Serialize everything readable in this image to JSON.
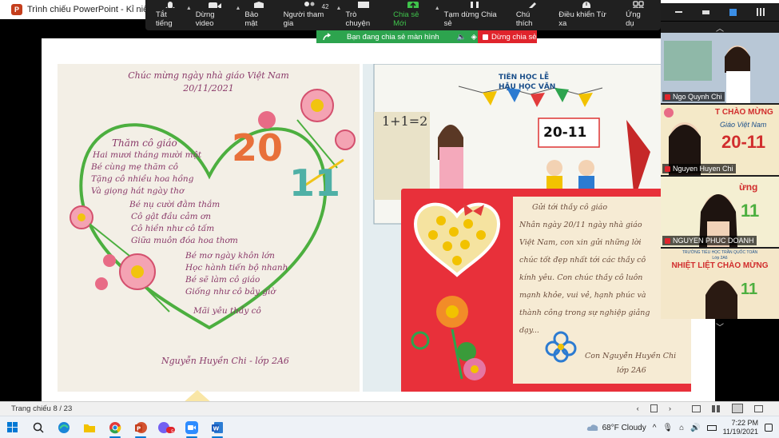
{
  "window": {
    "title": "Trình chiếu PowerPoint  -  Kỉ niệm ngày",
    "app_icon_letter": "P"
  },
  "zoom_toolbar": {
    "items": [
      {
        "key": "mute",
        "label": "Tắt tiếng",
        "icon": "microphone-icon"
      },
      {
        "key": "video",
        "label": "Dừng video",
        "icon": "video-camera-icon"
      },
      {
        "key": "security",
        "label": "Bảo mật",
        "icon": "shield-icon"
      },
      {
        "key": "participants",
        "label": "Người tham gia",
        "icon": "participants-icon",
        "count": "42"
      },
      {
        "key": "chat",
        "label": "Trò chuyện",
        "icon": "chat-bubble-icon"
      },
      {
        "key": "new_share",
        "label": "Chia sẻ Mới",
        "icon": "share-screen-icon"
      },
      {
        "key": "pause_share",
        "label": "Tạm dừng Chia sẻ",
        "icon": "pause-icon"
      },
      {
        "key": "annotate",
        "label": "Chú thích",
        "icon": "pencil-icon"
      },
      {
        "key": "remote",
        "label": "Điều khiển Từ xa",
        "icon": "mouse-icon"
      },
      {
        "key": "apps",
        "label": "Ứng dụ",
        "icon": "apps-icon"
      }
    ],
    "share_banner": "Bạn đang chia sẻ màn hình",
    "stop_share": "Dừng chia sẻ"
  },
  "slide": {
    "poem": {
      "title": [
        "Chúc mừng ngày nhà giáo Việt Nam",
        "20/11/2021"
      ],
      "stanza1": [
        "Thăm cô giáo",
        "Hai mươi tháng mười một",
        "Bé cùng mẹ thăm cô",
        "Tặng cô nhiều hoa hồng",
        "Và giọng hát ngày thơ"
      ],
      "stanza2": [
        "Bé nụ cười đằm thắm",
        "Cô gật đầu cảm ơn",
        "Cô hiền như cô tấm",
        "Giữa muôn đóa hoa thơm"
      ],
      "stanza3": [
        "Bé mơ ngày khôn lớn",
        "Học hành tiến bộ nhanh",
        "Bé sẽ làm cô giáo",
        "Giống như cô bây giờ"
      ],
      "closing": "Mãi yêu thầy cô",
      "signature": "Nguyễn Huyền Chi - lớp 2A6",
      "big_top": "20",
      "big_bottom": "11"
    },
    "card": {
      "board_title": [
        "TIÊN HỌC LỄ",
        "HẬU HỌC VĂN"
      ],
      "math": "1+1=2",
      "date": "20-11",
      "letter_lines": [
        "Gửi tới thầy cô giáo",
        "Nhân ngày 20/11 ngày nhà giáo",
        "Việt Nam, con xin gửi những lời",
        "chúc tốt đẹp nhất tới các thầy cô",
        "kính yêu. Con chúc thầy cô luôn",
        "mạnh khỏe, vui vẻ, hạnh phúc và",
        "thành công trong sự nghiệp giảng",
        "dạy..."
      ],
      "letter_signature": [
        "Con Nguyễn Huyền Chi",
        "lớp 2A6"
      ]
    }
  },
  "participants": [
    {
      "name": "Ngo Quynh Chi",
      "bg": "#c9b79a"
    },
    {
      "name": "Nguyen Huyen Chi",
      "bg": "#f2e6c4"
    },
    {
      "name": "NGUYEN PHUC DOANH",
      "bg": "#f4efd2"
    },
    {
      "name": "",
      "bg": "#f4e7c9"
    }
  ],
  "thumb_banners": {
    "t2": "T CHÀO MỪNG",
    "t2b": "Giáo Việt Nam",
    "t2c": "20-11",
    "t3": "ừng",
    "t3b": "11",
    "t4_school": "TRƯỜNG TIỂU HỌC TRẦN QUỐC TOẢN",
    "t4_class": "Lớp 2A6",
    "t4": "NHIỆT LIỆT CHÀO MỪNG",
    "t4b": "11"
  },
  "status_bar": {
    "slide_counter": "Trang chiếu 8 / 23"
  },
  "taskbar": {
    "badge": "5+",
    "weather": "68°F  Cloudy",
    "time": "7:22 PM",
    "date": "11/19/2021"
  },
  "colors": {
    "zoom_green": "#2da44e",
    "zoom_red": "#e0242c",
    "poem_ink": "#8a3a6a",
    "card_red": "#e8303a"
  }
}
